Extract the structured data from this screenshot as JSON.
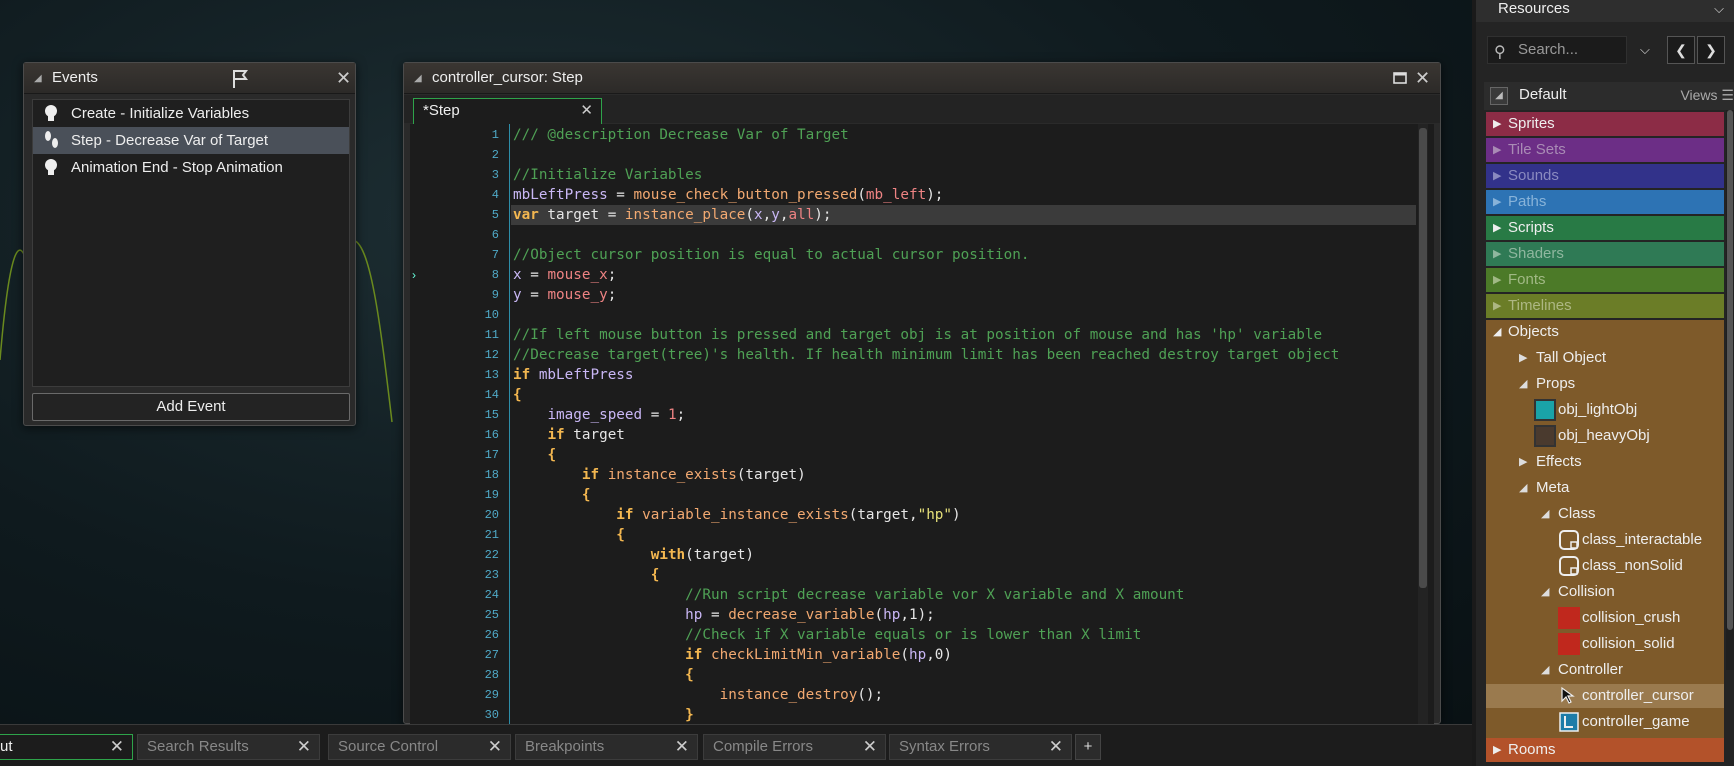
{
  "events_window": {
    "title": "Events",
    "items": [
      {
        "label": "Create - Initialize Variables",
        "icon": "lightbulb-icon",
        "selected": false
      },
      {
        "label": "Step - Decrease Var of Target",
        "icon": "footsteps-icon",
        "selected": true
      },
      {
        "label": "Animation End - Stop Animation",
        "icon": "lightbulb-icon",
        "selected": false
      }
    ],
    "add_event_label": "Add Event"
  },
  "editor": {
    "title": "controller_cursor: Step",
    "tab_label": "*Step",
    "current_line": 5,
    "lines": [
      {
        "n": "1",
        "t": [
          [
            "c",
            "/// @description Decrease Var of Target"
          ]
        ]
      },
      {
        "n": "2",
        "t": []
      },
      {
        "n": "3",
        "t": [
          [
            "c",
            "//Initialize Variables"
          ]
        ]
      },
      {
        "n": "4",
        "t": [
          [
            "v",
            "mbLeftPress"
          ],
          [
            "w",
            " = "
          ],
          [
            "f",
            "mouse_check_button_pressed"
          ],
          [
            "w",
            "("
          ],
          [
            "b",
            "mb_left"
          ],
          [
            "w",
            ");"
          ]
        ]
      },
      {
        "n": "5",
        "t": [
          [
            "k",
            "var"
          ],
          [
            "w",
            " target = "
          ],
          [
            "f",
            "instance_place"
          ],
          [
            "w",
            "("
          ],
          [
            "v",
            "x"
          ],
          [
            "w",
            ","
          ],
          [
            "v",
            "y"
          ],
          [
            "w",
            ","
          ],
          [
            "b",
            "all"
          ],
          [
            "w",
            ");"
          ]
        ]
      },
      {
        "n": "6",
        "t": []
      },
      {
        "n": "7",
        "t": [
          [
            "c",
            "//Object cursor position is equal to actual cursor position."
          ]
        ]
      },
      {
        "n": "8",
        "t": [
          [
            "v",
            "x"
          ],
          [
            "w",
            " = "
          ],
          [
            "b",
            "mouse_x"
          ],
          [
            "w",
            ";"
          ]
        ]
      },
      {
        "n": "9",
        "t": [
          [
            "v",
            "y"
          ],
          [
            "w",
            " = "
          ],
          [
            "b",
            "mouse_y"
          ],
          [
            "w",
            ";"
          ]
        ]
      },
      {
        "n": "10",
        "t": []
      },
      {
        "n": "11",
        "t": [
          [
            "c",
            "//If left mouse button is pressed and target obj is at position of mouse and has 'hp' variable"
          ]
        ]
      },
      {
        "n": "12",
        "t": [
          [
            "c",
            "//Decrease target(tree)'s health. If health minimum limit has been reached destroy target object"
          ]
        ]
      },
      {
        "n": "13",
        "t": [
          [
            "k",
            "if"
          ],
          [
            "w",
            " "
          ],
          [
            "v",
            "mbLeftPress"
          ]
        ]
      },
      {
        "n": "14",
        "t": [
          [
            "k",
            "{"
          ]
        ]
      },
      {
        "n": "15",
        "t": [
          [
            "w",
            "    "
          ],
          [
            "v",
            "image_speed"
          ],
          [
            "w",
            " = "
          ],
          [
            "n",
            "1"
          ],
          [
            "w",
            ";"
          ]
        ]
      },
      {
        "n": "16",
        "t": [
          [
            "w",
            "    "
          ],
          [
            "k",
            "if"
          ],
          [
            "w",
            " target"
          ]
        ]
      },
      {
        "n": "17",
        "t": [
          [
            "w",
            "    "
          ],
          [
            "k",
            "{"
          ]
        ]
      },
      {
        "n": "18",
        "t": [
          [
            "w",
            "        "
          ],
          [
            "k",
            "if"
          ],
          [
            "w",
            " "
          ],
          [
            "f",
            "instance_exists"
          ],
          [
            "w",
            "(target)"
          ]
        ]
      },
      {
        "n": "19",
        "t": [
          [
            "w",
            "        "
          ],
          [
            "k",
            "{"
          ]
        ]
      },
      {
        "n": "20",
        "t": [
          [
            "w",
            "            "
          ],
          [
            "k",
            "if"
          ],
          [
            "w",
            " "
          ],
          [
            "f",
            "variable_instance_exists"
          ],
          [
            "w",
            "(target,"
          ],
          [
            "s",
            "\"hp\""
          ],
          [
            "w",
            ")"
          ]
        ]
      },
      {
        "n": "21",
        "t": [
          [
            "w",
            "            "
          ],
          [
            "k",
            "{"
          ]
        ]
      },
      {
        "n": "22",
        "t": [
          [
            "w",
            "                "
          ],
          [
            "k",
            "with"
          ],
          [
            "w",
            "(target)"
          ]
        ]
      },
      {
        "n": "23",
        "t": [
          [
            "w",
            "                "
          ],
          [
            "k",
            "{"
          ]
        ]
      },
      {
        "n": "24",
        "t": [
          [
            "w",
            "                    "
          ],
          [
            "c",
            "//Run script decrease variable vor X variable and X amount"
          ]
        ]
      },
      {
        "n": "25",
        "t": [
          [
            "w",
            "                    "
          ],
          [
            "v",
            "hp"
          ],
          [
            "w",
            " = "
          ],
          [
            "f",
            "decrease_variable"
          ],
          [
            "w",
            "("
          ],
          [
            "v",
            "hp"
          ],
          [
            "w",
            ",1);"
          ]
        ]
      },
      {
        "n": "26",
        "t": [
          [
            "w",
            "                    "
          ],
          [
            "c",
            "//Check if X variable equals or is lower than X limit"
          ]
        ]
      },
      {
        "n": "27",
        "t": [
          [
            "w",
            "                    "
          ],
          [
            "k",
            "if"
          ],
          [
            "w",
            " "
          ],
          [
            "f",
            "checkLimitMin_variable"
          ],
          [
            "w",
            "("
          ],
          [
            "v",
            "hp"
          ],
          [
            "w",
            ",0)"
          ]
        ]
      },
      {
        "n": "28",
        "t": [
          [
            "w",
            "                    "
          ],
          [
            "k",
            "{"
          ]
        ]
      },
      {
        "n": "29",
        "t": [
          [
            "w",
            "                        "
          ],
          [
            "f",
            "instance_destroy"
          ],
          [
            "w",
            "();"
          ]
        ]
      },
      {
        "n": "30",
        "t": [
          [
            "w",
            "                    "
          ],
          [
            "k",
            "}"
          ]
        ]
      }
    ]
  },
  "bottom_tabs": [
    {
      "label": "ut",
      "active": true
    },
    {
      "label": "Search Results",
      "active": false
    },
    {
      "label": "Source Control",
      "active": false
    },
    {
      "label": "Breakpoints",
      "active": false
    },
    {
      "label": "Compile Errors",
      "active": false
    },
    {
      "label": "Syntax Errors",
      "active": false
    }
  ],
  "bottom_add_label": "+",
  "resources": {
    "title": "Resources",
    "search_placeholder": "Search...",
    "group_label": "Default",
    "views_label": "Views",
    "categories": [
      {
        "label": "Sprites",
        "color": "#8c2c46",
        "text": "#eeeeee"
      },
      {
        "label": "Tile Sets",
        "color": "#6c2e86",
        "text": "#a98bb5"
      },
      {
        "label": "Sounds",
        "color": "#32328a",
        "text": "#8a8ac0"
      },
      {
        "label": "Paths",
        "color": "#2d73b4",
        "text": "#88b3d9"
      },
      {
        "label": "Scripts",
        "color": "#287a45",
        "text": "#eeeeee"
      },
      {
        "label": "Shaders",
        "color": "#2f7a55",
        "text": "#8fb79f"
      },
      {
        "label": "Fonts",
        "color": "#4c7a28",
        "text": "#a1b985"
      },
      {
        "label": "Timelines",
        "color": "#6b7d27",
        "text": "#adb783"
      }
    ],
    "objects_label": "Objects",
    "objects_color": "#7e5a2a",
    "tree": [
      {
        "label": "Tall Object",
        "level": 1,
        "arrow": "right"
      },
      {
        "label": "Props",
        "level": 1,
        "arrow": "down"
      },
      {
        "label": "obj_lightObj",
        "level": 2,
        "icon": "teal-square-icon"
      },
      {
        "label": "obj_heavyObj",
        "level": 2,
        "icon": "brown-square-icon"
      },
      {
        "label": "Effects",
        "level": 1,
        "arrow": "right"
      },
      {
        "label": "Meta",
        "level": 1,
        "arrow": "down"
      },
      {
        "label": "Class",
        "level": 2,
        "arrow": "down"
      },
      {
        "label": "class_interactable",
        "level": 3,
        "icon": "blank-object-icon"
      },
      {
        "label": "class_nonSolid",
        "level": 3,
        "icon": "blank-object-icon"
      },
      {
        "label": "Collision",
        "level": 2,
        "arrow": "down"
      },
      {
        "label": "collision_crush",
        "level": 3,
        "icon": "red-square-icon"
      },
      {
        "label": "collision_solid",
        "level": 3,
        "icon": "red-square-icon"
      },
      {
        "label": "Controller",
        "level": 2,
        "arrow": "down"
      },
      {
        "label": "controller_cursor",
        "level": 3,
        "icon": "cursor-icon",
        "selected": true
      },
      {
        "label": "controller_game",
        "level": 3,
        "icon": "game-controller-icon"
      }
    ],
    "rooms_label": "Rooms",
    "rooms_color": "#b3522a"
  }
}
